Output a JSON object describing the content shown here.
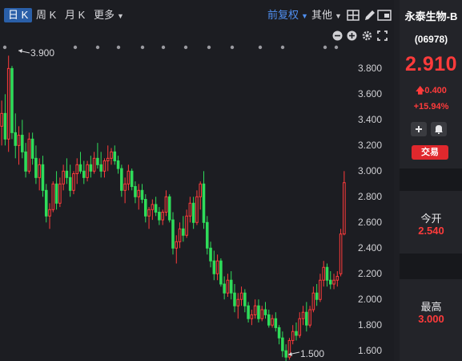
{
  "toolbar": {
    "tabs": [
      {
        "label": "日 K",
        "active": true
      },
      {
        "label": "周 K",
        "active": false
      },
      {
        "label": "月 K",
        "active": false
      },
      {
        "label": "更多",
        "active": false
      }
    ],
    "adjust_label": "前复权",
    "other_label": "其他"
  },
  "chart_controls": [
    "minus-circle-icon",
    "plus-circle-icon",
    "gear-icon",
    "fullscreen-icon"
  ],
  "chart_data": {
    "type": "candlestick",
    "y_ticks": [
      "3.800",
      "3.600",
      "3.400",
      "3.200",
      "3.000",
      "2.800",
      "2.600",
      "2.400",
      "2.200",
      "2.000",
      "1.800",
      "1.600"
    ],
    "ylim": [
      1.52,
      3.94
    ],
    "annotations": {
      "high": "3.900",
      "low": "1.500"
    },
    "up_color": "#ff3b3b",
    "down_color": "#2fdc5a",
    "candles": [
      [
        3.35,
        3.55,
        3.2,
        3.45
      ],
      [
        3.45,
        3.6,
        3.2,
        3.25
      ],
      [
        3.25,
        3.9,
        3.15,
        3.8
      ],
      [
        3.8,
        3.82,
        3.25,
        3.3
      ],
      [
        3.3,
        3.45,
        3.1,
        3.2
      ],
      [
        3.2,
        3.35,
        3.05,
        3.28
      ],
      [
        3.28,
        3.4,
        3.1,
        3.15
      ],
      [
        3.15,
        3.22,
        2.95,
        3.0
      ],
      [
        3.0,
        3.3,
        2.98,
        3.25
      ],
      [
        3.25,
        3.3,
        3.05,
        3.1
      ],
      [
        3.1,
        3.2,
        2.9,
        2.95
      ],
      [
        2.95,
        3.1,
        2.85,
        3.05
      ],
      [
        3.05,
        3.12,
        2.8,
        2.85
      ],
      [
        2.85,
        2.9,
        2.6,
        2.65
      ],
      [
        2.65,
        2.75,
        2.55,
        2.7
      ],
      [
        2.7,
        2.92,
        2.68,
        2.9
      ],
      [
        2.9,
        3.0,
        2.7,
        2.75
      ],
      [
        2.75,
        2.95,
        2.72,
        2.9
      ],
      [
        2.9,
        3.05,
        2.85,
        3.0
      ],
      [
        3.0,
        3.1,
        2.9,
        2.95
      ],
      [
        2.95,
        3.05,
        2.8,
        2.85
      ],
      [
        2.85,
        3.0,
        2.82,
        2.98
      ],
      [
        2.98,
        3.1,
        2.9,
        3.05
      ],
      [
        3.05,
        3.15,
        2.98,
        3.0
      ],
      [
        3.0,
        3.08,
        2.9,
        2.95
      ],
      [
        2.95,
        3.08,
        2.92,
        3.05
      ],
      [
        3.05,
        3.12,
        2.95,
        3.0
      ],
      [
        3.0,
        3.15,
        2.98,
        3.1
      ],
      [
        3.1,
        3.22,
        3.02,
        3.05
      ],
      [
        3.05,
        3.15,
        2.95,
        3.0
      ],
      [
        3.0,
        3.1,
        2.95,
        3.08
      ],
      [
        3.08,
        3.2,
        3.0,
        3.1
      ],
      [
        3.1,
        3.18,
        3.05,
        3.15
      ],
      [
        3.15,
        3.2,
        3.05,
        3.08
      ],
      [
        3.08,
        3.12,
        2.98,
        3.02
      ],
      [
        3.02,
        3.05,
        2.8,
        2.85
      ],
      [
        2.85,
        2.95,
        2.75,
        2.9
      ],
      [
        2.9,
        3.05,
        2.85,
        3.0
      ],
      [
        3.0,
        3.02,
        2.85,
        2.88
      ],
      [
        2.88,
        2.92,
        2.75,
        2.8
      ],
      [
        2.8,
        2.9,
        2.7,
        2.85
      ],
      [
        2.85,
        2.9,
        2.75,
        2.78
      ],
      [
        2.78,
        2.82,
        2.6,
        2.65
      ],
      [
        2.65,
        2.72,
        2.55,
        2.7
      ],
      [
        2.7,
        2.78,
        2.62,
        2.74
      ],
      [
        2.74,
        2.8,
        2.65,
        2.68
      ],
      [
        2.68,
        2.72,
        2.58,
        2.62
      ],
      [
        2.62,
        2.7,
        2.58,
        2.68
      ],
      [
        2.68,
        2.85,
        2.65,
        2.8
      ],
      [
        2.8,
        2.82,
        2.6,
        2.62
      ],
      [
        2.62,
        2.68,
        2.35,
        2.4
      ],
      [
        2.4,
        2.5,
        2.28,
        2.45
      ],
      [
        2.45,
        2.6,
        2.4,
        2.55
      ],
      [
        2.55,
        2.65,
        2.45,
        2.5
      ],
      [
        2.5,
        2.7,
        2.48,
        2.65
      ],
      [
        2.65,
        2.8,
        2.6,
        2.75
      ],
      [
        2.75,
        2.8,
        2.55,
        2.6
      ],
      [
        2.6,
        2.85,
        2.58,
        2.8
      ],
      [
        2.8,
        2.92,
        2.7,
        2.9
      ],
      [
        2.9,
        3.0,
        2.55,
        2.6
      ],
      [
        2.6,
        2.65,
        2.35,
        2.4
      ],
      [
        2.4,
        2.45,
        2.25,
        2.3
      ],
      [
        2.3,
        2.38,
        2.15,
        2.2
      ],
      [
        2.2,
        2.35,
        2.15,
        2.3
      ],
      [
        2.3,
        2.32,
        2.1,
        2.12
      ],
      [
        2.12,
        2.18,
        2.0,
        2.05
      ],
      [
        2.05,
        2.2,
        2.02,
        2.15
      ],
      [
        2.15,
        2.22,
        2.0,
        2.05
      ],
      [
        2.05,
        2.12,
        1.9,
        1.95
      ],
      [
        1.95,
        2.05,
        1.85,
        2.0
      ],
      [
        2.0,
        2.1,
        1.95,
        2.05
      ],
      [
        2.05,
        2.08,
        1.9,
        1.95
      ],
      [
        1.95,
        1.98,
        1.82,
        1.85
      ],
      [
        1.85,
        1.92,
        1.8,
        1.88
      ],
      [
        1.88,
        2.0,
        1.85,
        1.95
      ],
      [
        1.95,
        2.0,
        1.82,
        1.85
      ],
      [
        1.85,
        1.95,
        1.83,
        1.92
      ],
      [
        1.92,
        1.98,
        1.85,
        1.88
      ],
      [
        1.88,
        1.92,
        1.78,
        1.8
      ],
      [
        1.8,
        1.88,
        1.78,
        1.85
      ],
      [
        1.85,
        1.9,
        1.75,
        1.78
      ],
      [
        1.78,
        1.8,
        1.65,
        1.7
      ],
      [
        1.7,
        1.75,
        1.55,
        1.6
      ],
      [
        1.6,
        1.65,
        1.5,
        1.55
      ],
      [
        1.55,
        1.7,
        1.53,
        1.68
      ],
      [
        1.68,
        1.8,
        1.65,
        1.75
      ],
      [
        1.75,
        1.82,
        1.68,
        1.72
      ],
      [
        1.72,
        1.9,
        1.7,
        1.85
      ],
      [
        1.85,
        1.95,
        1.8,
        1.9
      ],
      [
        1.9,
        1.98,
        1.75,
        1.8
      ],
      [
        1.8,
        1.95,
        1.78,
        1.92
      ],
      [
        1.92,
        2.1,
        1.9,
        2.05
      ],
      [
        2.05,
        2.12,
        1.95,
        2.0
      ],
      [
        2.0,
        2.2,
        1.98,
        2.15
      ],
      [
        2.15,
        2.3,
        2.1,
        2.25
      ],
      [
        2.25,
        2.28,
        2.1,
        2.15
      ],
      [
        2.15,
        2.22,
        2.08,
        2.12
      ],
      [
        2.12,
        2.2,
        2.08,
        2.15
      ],
      [
        2.15,
        2.22,
        2.1,
        2.18
      ],
      [
        2.2,
        2.55,
        2.18,
        2.51
      ],
      [
        2.51,
        3.0,
        2.5,
        2.91
      ]
    ]
  },
  "stock": {
    "name": "永泰生物-B",
    "code": "(06978)",
    "price": "2.910",
    "change": "0.400",
    "change_pct": "+15.94%",
    "trade_label": "交易",
    "open_label": "今开",
    "open_value": "2.540",
    "high_label": "最高",
    "high_value": "3.000"
  }
}
